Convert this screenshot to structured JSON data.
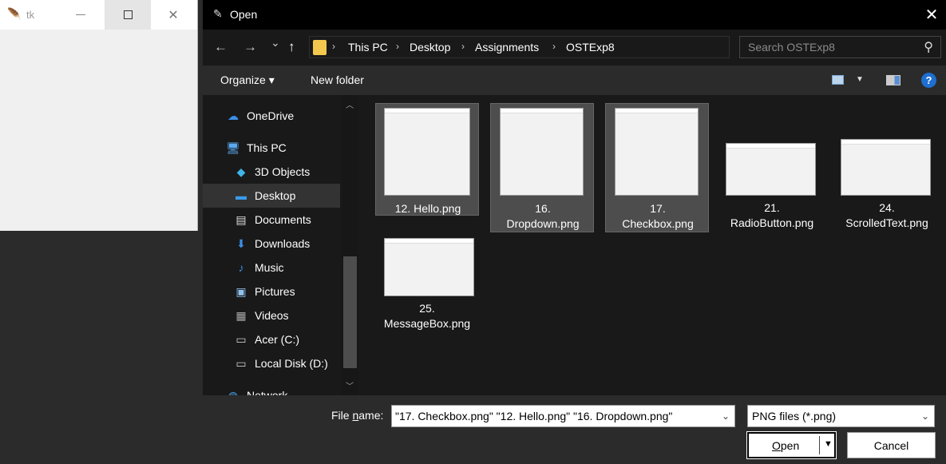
{
  "tk_window": {
    "title": "tk",
    "minimize": "—",
    "close": "✕"
  },
  "dialog": {
    "title": "Open",
    "close": "✕",
    "nav_buttons": {
      "back": "←",
      "forward": "→",
      "recent": "⌄",
      "up": "↑"
    },
    "breadcrumb": [
      "This PC",
      "Desktop",
      "Assignments",
      "OSTExp8"
    ],
    "breadcrumb_sep": "›",
    "search_placeholder": "Search OSTExp8",
    "toolbar": {
      "organize": "Organize ▾",
      "new_folder": "New folder",
      "help": "?"
    },
    "nav_items": [
      {
        "label": "OneDrive",
        "icon": "cloud-icon"
      },
      {
        "label": "This PC",
        "icon": "computer-icon"
      },
      {
        "label": "3D Objects",
        "icon": "cube-icon"
      },
      {
        "label": "Desktop",
        "icon": "desktop-icon"
      },
      {
        "label": "Documents",
        "icon": "document-icon"
      },
      {
        "label": "Downloads",
        "icon": "download-icon"
      },
      {
        "label": "Music",
        "icon": "music-icon"
      },
      {
        "label": "Pictures",
        "icon": "picture-icon"
      },
      {
        "label": "Videos",
        "icon": "video-icon"
      },
      {
        "label": "Acer (C:)",
        "icon": "drive-icon"
      },
      {
        "label": "Local Disk (D:)",
        "icon": "drive-icon"
      },
      {
        "label": "Network",
        "icon": "network-icon"
      }
    ],
    "selected_nav": "Desktop",
    "files": [
      {
        "name_line1": "12. Hello.png",
        "name_line2": "",
        "selected": true
      },
      {
        "name_line1": "16.",
        "name_line2": "Dropdown.png",
        "selected": true
      },
      {
        "name_line1": "17.",
        "name_line2": "Checkbox.png",
        "selected": true
      },
      {
        "name_line1": "21.",
        "name_line2": "RadioButton.png",
        "selected": false
      },
      {
        "name_line1": "24.",
        "name_line2": "ScrolledText.png",
        "selected": false
      },
      {
        "name_line1": "25.",
        "name_line2": "MessageBox.png",
        "selected": false
      }
    ],
    "file_name_label_pre": "File ",
    "file_name_label_u": "n",
    "file_name_label_post": "ame:",
    "file_name_value": "\"17. Checkbox.png\" \"12. Hello.png\" \"16. Dropdown.png\"",
    "file_type_value": "PNG files (*.png)",
    "open_label_u": "O",
    "open_label_rest": "pen",
    "cancel_label": "Cancel"
  }
}
